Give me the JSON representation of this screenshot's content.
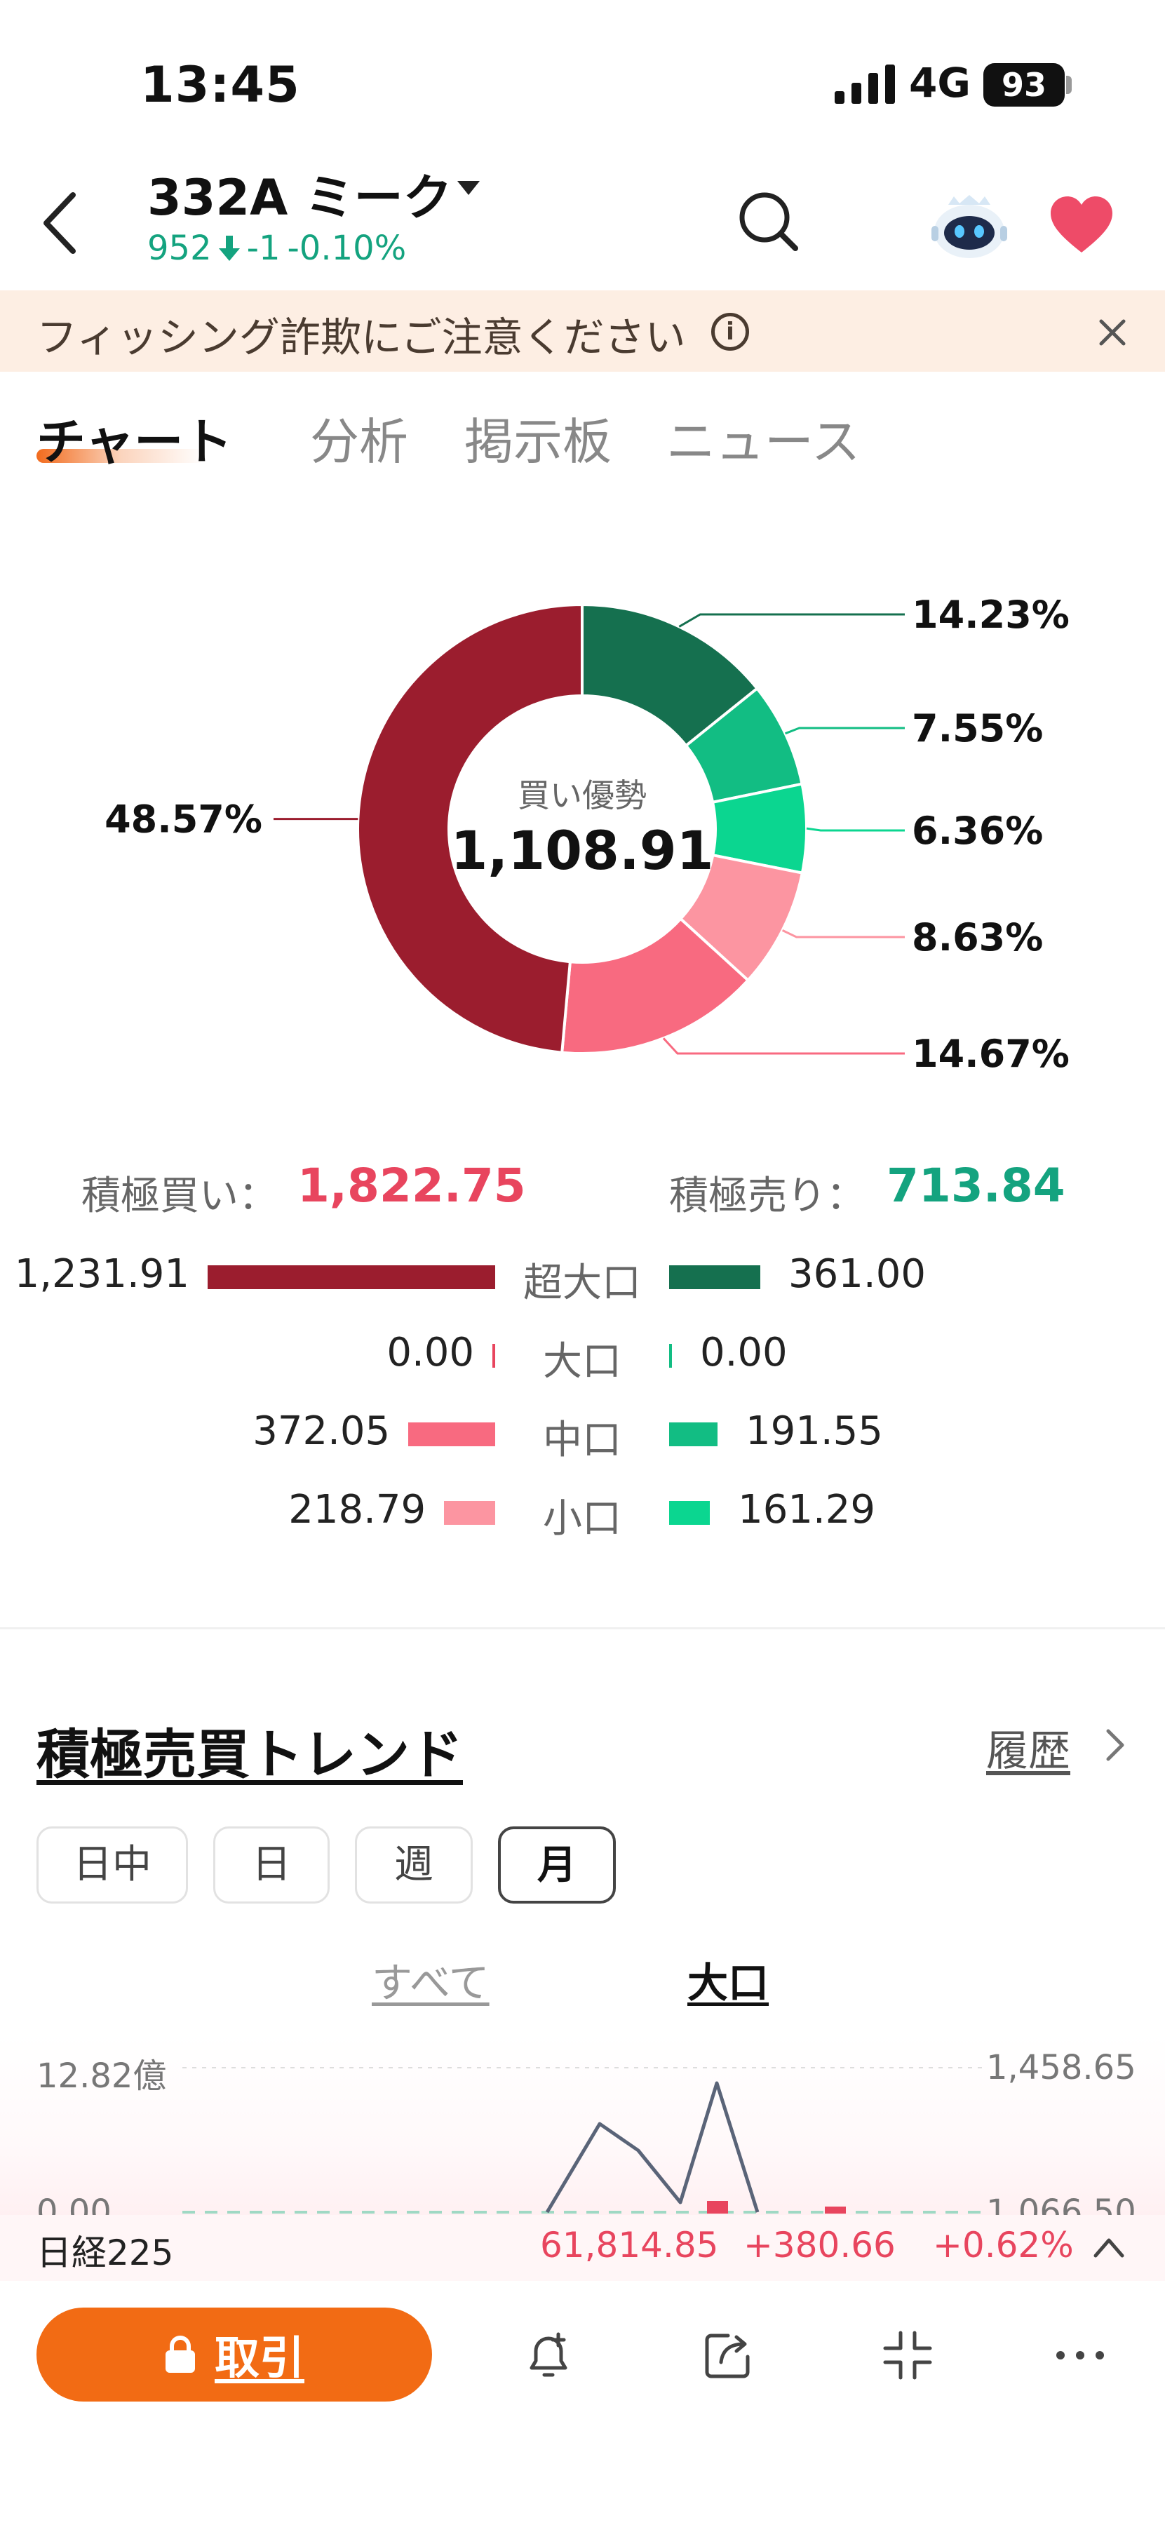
{
  "status_bar": {
    "time": "13:45",
    "network": "4G",
    "battery": "93"
  },
  "header": {
    "ticker": "332A  ミーク",
    "price": "952",
    "change": "-1",
    "change_pct": "-0.10%",
    "icons": [
      "back-arrow-icon",
      "search-icon",
      "assistant-robot-icon",
      "heart-icon"
    ],
    "colors": {
      "down": "#14a37f",
      "favorite": "#ee4b68"
    }
  },
  "banner": {
    "text": "フィッシング詐欺にご注意ください",
    "info_icon": "ⓘ",
    "close_icon": "close-icon"
  },
  "tabs": [
    {
      "label": "チャート",
      "active": true
    },
    {
      "label": "分析",
      "active": false
    },
    {
      "label": "掲示板",
      "active": false
    },
    {
      "label": "ニュース",
      "active": false
    }
  ],
  "chart_data": {
    "type": "pie",
    "style": "donut",
    "center_label": "買い優勢",
    "center_value": "1,108.91",
    "slices": [
      {
        "label": "14.23%",
        "value": 14.23,
        "color": "#15704f"
      },
      {
        "label": "7.55%",
        "value": 7.55,
        "color": "#12bd83"
      },
      {
        "label": "6.36%",
        "value": 6.36,
        "color": "#0bd690"
      },
      {
        "label": "8.63%",
        "value": 8.63,
        "color": "#fc95a1"
      },
      {
        "label": "14.67%",
        "value": 14.67,
        "color": "#f86a80"
      },
      {
        "label": "48.57%",
        "value": 48.57,
        "color": "#9b1d2e"
      }
    ]
  },
  "flow": {
    "buy_label": "積極買い：",
    "buy_total": "1,822.75",
    "sell_label": "積極売り：",
    "sell_total": "713.84",
    "rows": [
      {
        "category": "超大口",
        "buy": "1,231.91",
        "sell": "361.00",
        "buy_value": 1231.91,
        "sell_value": 361.0,
        "buy_color": "#9b1d2e",
        "sell_color": "#15704f"
      },
      {
        "category": "大口",
        "buy": "0.00",
        "sell": "0.00",
        "buy_value": 0,
        "sell_value": 0,
        "buy_color": "#e8455e",
        "sell_color": "#12bd83"
      },
      {
        "category": "中口",
        "buy": "372.05",
        "sell": "191.55",
        "buy_value": 372.05,
        "sell_value": 191.55,
        "buy_color": "#f86a80",
        "sell_color": "#12bd83"
      },
      {
        "category": "小口",
        "buy": "218.79",
        "sell": "161.29",
        "buy_value": 218.79,
        "sell_value": 161.29,
        "buy_color": "#fc95a1",
        "sell_color": "#0bd690"
      }
    ]
  },
  "trend": {
    "title": "積極売買トレンド",
    "history": "履歴",
    "periods": [
      {
        "label": "日中",
        "active": false
      },
      {
        "label": "日",
        "active": false
      },
      {
        "label": "週",
        "active": false
      },
      {
        "label": "月",
        "active": true
      }
    ],
    "sub_tabs": [
      {
        "label": "すべて",
        "active": false
      },
      {
        "label": "大口",
        "active": true
      }
    ],
    "left_axis_top": "12.82億",
    "left_axis_mid": "0.00",
    "right_axis_top": "1,458.65",
    "right_axis_mid": "1,066.50"
  },
  "index_ticker": {
    "name": "日経225",
    "price": "61,814.85",
    "change": "+380.66",
    "change_pct": "+0.62%"
  },
  "bottom_bar": {
    "trade_label": "取引",
    "icons": [
      "lock-icon",
      "price-alert-icon",
      "share-icon",
      "collapse-icon",
      "more-icon"
    ],
    "accent": "#f26b14"
  }
}
